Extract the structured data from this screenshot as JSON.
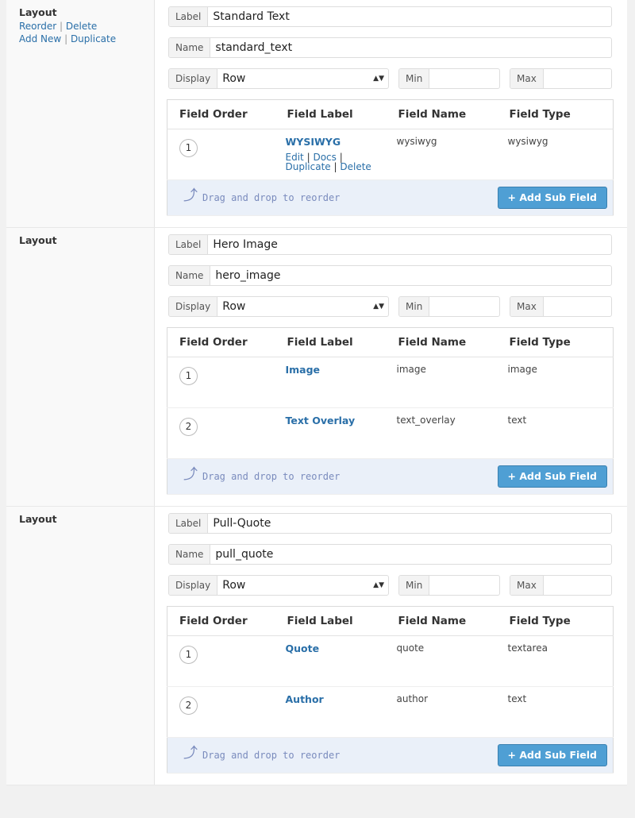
{
  "common": {
    "layout_title": "Layout",
    "reorder": "Reorder",
    "delete": "Delete",
    "add_new": "Add New",
    "duplicate": "Duplicate",
    "sep": "|",
    "label_prefix": "Label",
    "name_prefix": "Name",
    "display_prefix": "Display",
    "min_prefix": "Min",
    "max_prefix": "Max",
    "col_order": "Field Order",
    "col_label": "Field Label",
    "col_name": "Field Name",
    "col_type": "Field Type",
    "edit": "Edit",
    "docs": "Docs",
    "field_duplicate": "Duplicate",
    "field_delete": "Delete",
    "drag_hint": "Drag and drop to reorder",
    "add_sub_field": "+ Add Sub Field",
    "select_arrows": "▲▼"
  },
  "layouts": [
    {
      "label": "Standard Text",
      "name": "standard_text",
      "display": "Row",
      "min": "",
      "max": "",
      "show_actions": true,
      "links_shown": true,
      "fields": [
        {
          "order": "1",
          "label": "WYSIWYG",
          "name": "wysiwyg",
          "type": "wysiwyg"
        }
      ]
    },
    {
      "label": "Hero Image",
      "name": "hero_image",
      "display": "Row",
      "min": "",
      "max": "",
      "show_actions": false,
      "links_shown": false,
      "fields": [
        {
          "order": "1",
          "label": "Image",
          "name": "image",
          "type": "image"
        },
        {
          "order": "2",
          "label": "Text Overlay",
          "name": "text_overlay",
          "type": "text"
        }
      ]
    },
    {
      "label": "Pull-Quote",
      "name": "pull_quote",
      "display": "Row",
      "min": "",
      "max": "",
      "show_actions": false,
      "links_shown": false,
      "fields": [
        {
          "order": "1",
          "label": "Quote",
          "name": "quote",
          "type": "textarea"
        },
        {
          "order": "2",
          "label": "Author",
          "name": "author",
          "type": "text"
        }
      ]
    }
  ],
  "colors": {
    "link": "#2a6fa8",
    "button": "#4f9fd4",
    "footer_bg": "#eaf0f9"
  }
}
